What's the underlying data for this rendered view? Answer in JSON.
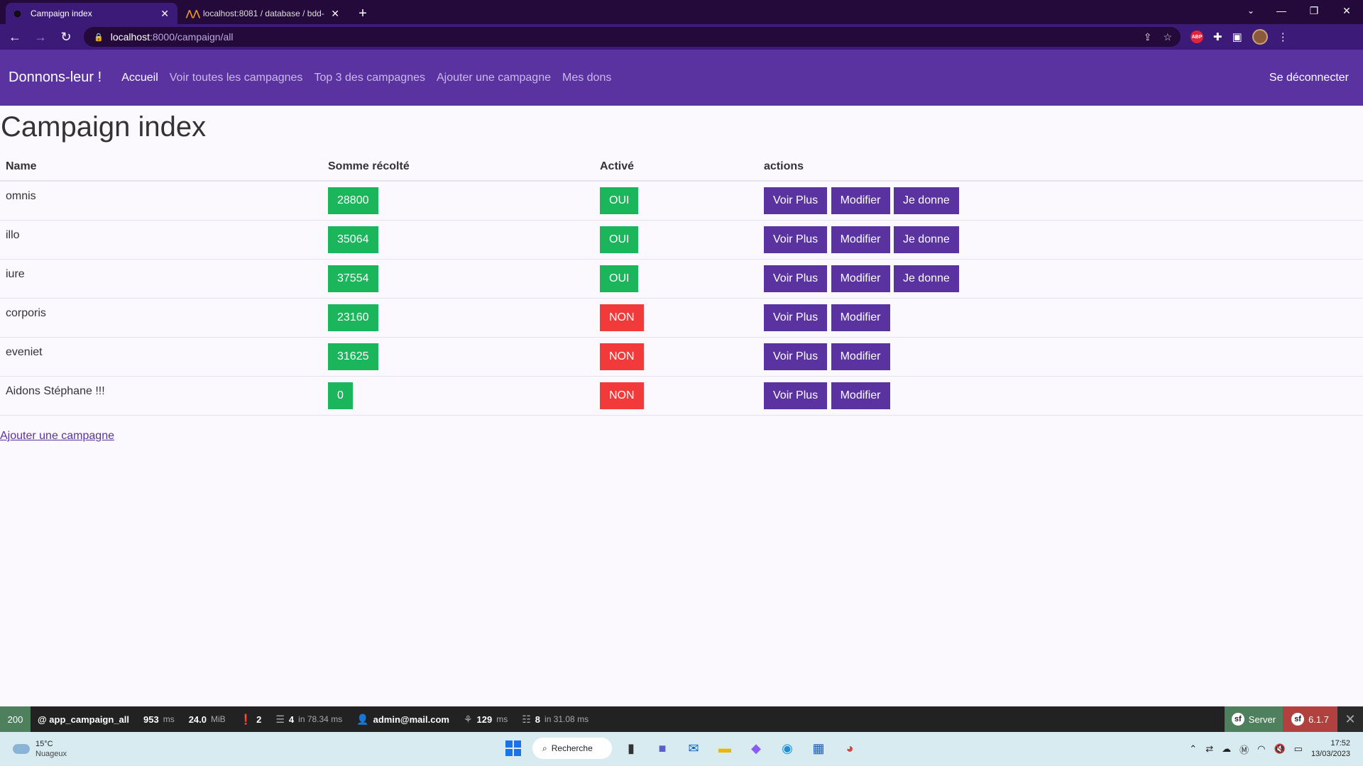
{
  "browser": {
    "tabs": [
      {
        "title": "Campaign index",
        "active": true
      },
      {
        "title": "localhost:8081 / database / bdd-",
        "active": false
      }
    ],
    "url_host": "localhost",
    "url_path": ":8000/campaign/all"
  },
  "navbar": {
    "brand": "Donnons-leur !",
    "links": [
      "Accueil",
      "Voir toutes les campagnes",
      "Top 3 des campagnes",
      "Ajouter une campagne",
      "Mes dons"
    ],
    "logout": "Se déconnecter"
  },
  "page": {
    "title": "Campaign index",
    "columns": [
      "Name",
      "Somme récolté",
      "Activé",
      "actions"
    ],
    "rows": [
      {
        "name": "omnis",
        "amount": "28800",
        "active": "OUI",
        "actions": [
          "Voir Plus",
          "Modifier",
          "Je donne"
        ]
      },
      {
        "name": "illo",
        "amount": "35064",
        "active": "OUI",
        "actions": [
          "Voir Plus",
          "Modifier",
          "Je donne"
        ]
      },
      {
        "name": "iure",
        "amount": "37554",
        "active": "OUI",
        "actions": [
          "Voir Plus",
          "Modifier",
          "Je donne"
        ]
      },
      {
        "name": "corporis",
        "amount": "23160",
        "active": "NON",
        "actions": [
          "Voir Plus",
          "Modifier"
        ]
      },
      {
        "name": "eveniet",
        "amount": "31625",
        "active": "NON",
        "actions": [
          "Voir Plus",
          "Modifier"
        ]
      },
      {
        "name": "Aidons Stéphane !!!",
        "amount": "0",
        "active": "NON",
        "actions": [
          "Voir Plus",
          "Modifier"
        ]
      }
    ],
    "add_link": "Ajouter une campagne"
  },
  "debug_toolbar": {
    "status": "200",
    "route": "@ app_campaign_all",
    "time_value": "953",
    "time_unit": "ms",
    "memory_value": "24.0",
    "memory_unit": "MiB",
    "errors": "2",
    "cache_value": "4",
    "cache_detail": "in 78.34 ms",
    "user": "admin@mail.com",
    "twig_value": "129",
    "twig_unit": "ms",
    "db_value": "8",
    "db_detail": "in 31.08 ms",
    "server_label": "Server",
    "version": "6.1.7"
  },
  "taskbar": {
    "temperature": "15°C",
    "weather": "Nuageux",
    "search_label": "Recherche",
    "time": "17:52",
    "date": "13/03/2023"
  },
  "colors": {
    "primary": "#5a33a0",
    "success": "#1bb55c",
    "danger": "#f23a3a"
  }
}
